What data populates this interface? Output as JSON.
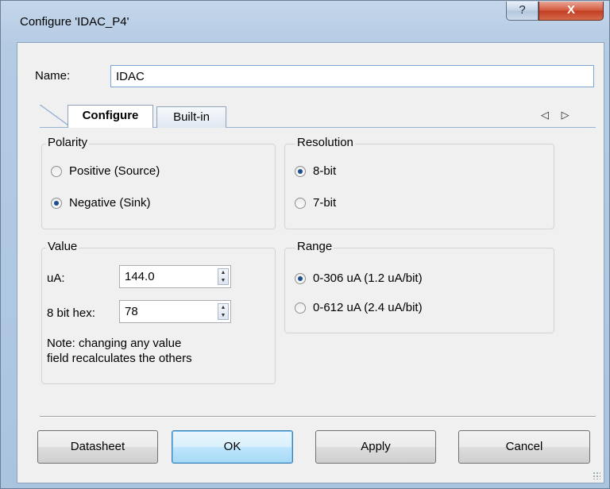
{
  "window": {
    "title": "Configure 'IDAC_P4'",
    "help_glyph": "?",
    "close_glyph": "X"
  },
  "name_field": {
    "label": "Name:",
    "value": "IDAC"
  },
  "tabs": [
    {
      "label": "Configure",
      "active": true
    },
    {
      "label": "Built-in",
      "active": false
    }
  ],
  "tab_scroll_glyphs": "◁ ▷",
  "polarity": {
    "title": "Polarity",
    "options": [
      {
        "label": "Positive (Source)",
        "checked": false
      },
      {
        "label": "Negative (Sink)",
        "checked": true
      }
    ]
  },
  "resolution": {
    "title": "Resolution",
    "options": [
      {
        "label": "8-bit",
        "checked": true
      },
      {
        "label": "7-bit",
        "checked": false
      }
    ]
  },
  "value_group": {
    "title": "Value",
    "ua_label": "uA:",
    "ua_value": "144.0",
    "hex_label": "8 bit hex:",
    "hex_value": "78",
    "note_line1": "Note: changing any value",
    "note_line2": "field recalculates the others"
  },
  "range": {
    "title": "Range",
    "options": [
      {
        "label": "0-306 uA (1.2 uA/bit)",
        "checked": true
      },
      {
        "label": "0-612 uA (2.4 uA/bit)",
        "checked": false
      }
    ]
  },
  "buttons": {
    "datasheet": "Datasheet",
    "ok": "OK",
    "apply": "Apply",
    "cancel": "Cancel"
  },
  "colors": {
    "accent": "#3c7fb1",
    "title_bar": "#b4cbe4",
    "close_button": "#c13d22"
  }
}
